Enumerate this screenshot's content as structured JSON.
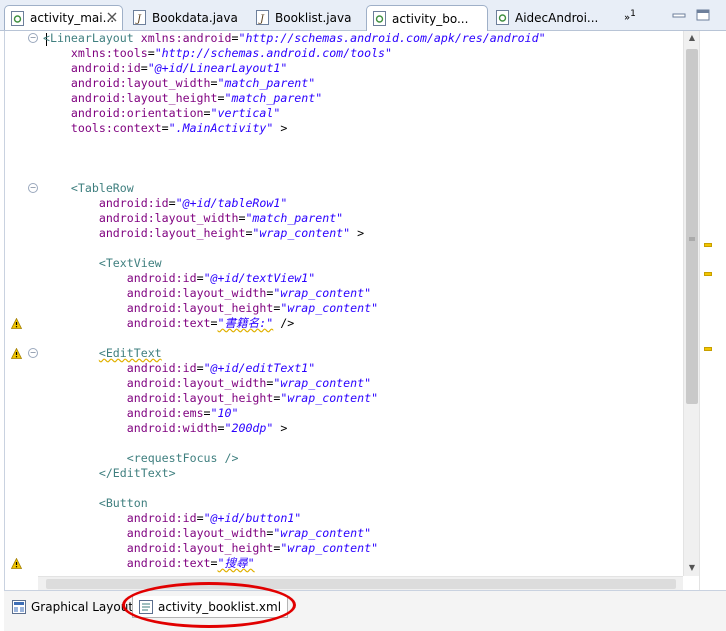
{
  "tabs": [
    {
      "label": "activity_mai...",
      "icon": "xml-file-icon",
      "has_close": true
    },
    {
      "label": "Bookdata.java",
      "icon": "java-file-icon",
      "has_close": false
    },
    {
      "label": "Booklist.java",
      "icon": "java-file-icon",
      "has_close": false
    },
    {
      "label": "activity_bo...",
      "icon": "xml-file-icon",
      "has_close": false
    },
    {
      "label": "AidecAndroi...",
      "icon": "xml-file-icon",
      "has_close": false
    }
  ],
  "overflow_count": "1",
  "code": [
    [
      [
        "tag",
        "<LinearLayout "
      ],
      [
        "attr",
        "xmlns:android"
      ],
      [
        "eq",
        "="
      ],
      [
        "val",
        "\"http://schemas.android.com/apk/res/android\""
      ]
    ],
    [
      [
        "pad",
        "    "
      ],
      [
        "attr",
        "xmlns:tools"
      ],
      [
        "eq",
        "="
      ],
      [
        "val",
        "\"http://schemas.android.com/tools\""
      ]
    ],
    [
      [
        "pad",
        "    "
      ],
      [
        "attr",
        "android:id"
      ],
      [
        "eq",
        "="
      ],
      [
        "val",
        "\"@+id/LinearLayout1\""
      ]
    ],
    [
      [
        "pad",
        "    "
      ],
      [
        "attr",
        "android:layout_width"
      ],
      [
        "eq",
        "="
      ],
      [
        "val",
        "\"match_parent\""
      ]
    ],
    [
      [
        "pad",
        "    "
      ],
      [
        "attr",
        "android:layout_height"
      ],
      [
        "eq",
        "="
      ],
      [
        "val",
        "\"match_parent\""
      ]
    ],
    [
      [
        "pad",
        "    "
      ],
      [
        "attr",
        "android:orientation"
      ],
      [
        "eq",
        "="
      ],
      [
        "val",
        "\"vertical\""
      ]
    ],
    [
      [
        "pad",
        "    "
      ],
      [
        "attr",
        "tools:context"
      ],
      [
        "eq",
        "="
      ],
      [
        "val",
        "\".MainActivity\""
      ],
      [
        "pun",
        " >"
      ]
    ],
    [],
    [],
    [],
    [
      [
        "pad",
        "    "
      ],
      [
        "tag",
        "<TableRow"
      ]
    ],
    [
      [
        "pad",
        "        "
      ],
      [
        "attr",
        "android:id"
      ],
      [
        "eq",
        "="
      ],
      [
        "val",
        "\"@+id/tableRow1\""
      ]
    ],
    [
      [
        "pad",
        "        "
      ],
      [
        "attr",
        "android:layout_width"
      ],
      [
        "eq",
        "="
      ],
      [
        "val",
        "\"match_parent\""
      ]
    ],
    [
      [
        "pad",
        "        "
      ],
      [
        "attr",
        "android:layout_height"
      ],
      [
        "eq",
        "="
      ],
      [
        "val",
        "\"wrap_content\""
      ],
      [
        "pun",
        " >"
      ]
    ],
    [],
    [
      [
        "pad",
        "        "
      ],
      [
        "tag",
        "<TextView"
      ]
    ],
    [
      [
        "pad",
        "            "
      ],
      [
        "attr",
        "android:id"
      ],
      [
        "eq",
        "="
      ],
      [
        "val",
        "\"@+id/textView1\""
      ]
    ],
    [
      [
        "pad",
        "            "
      ],
      [
        "attr",
        "android:layout_width"
      ],
      [
        "eq",
        "="
      ],
      [
        "val",
        "\"wrap_content\""
      ]
    ],
    [
      [
        "pad",
        "            "
      ],
      [
        "attr",
        "android:layout_height"
      ],
      [
        "eq",
        "="
      ],
      [
        "val",
        "\"wrap_content\""
      ]
    ],
    [
      [
        "pad",
        "            "
      ],
      [
        "attr",
        "android:text"
      ],
      [
        "eq",
        "="
      ],
      [
        "valsq",
        "\"書籍名:\""
      ],
      [
        "pun",
        " />"
      ]
    ],
    [],
    [
      [
        "pad",
        "        "
      ],
      [
        "tagsq",
        "<EditText"
      ]
    ],
    [
      [
        "pad",
        "            "
      ],
      [
        "attr",
        "android:id"
      ],
      [
        "eq",
        "="
      ],
      [
        "val",
        "\"@+id/editText1\""
      ]
    ],
    [
      [
        "pad",
        "            "
      ],
      [
        "attr",
        "android:layout_width"
      ],
      [
        "eq",
        "="
      ],
      [
        "val",
        "\"wrap_content\""
      ]
    ],
    [
      [
        "pad",
        "            "
      ],
      [
        "attr",
        "android:layout_height"
      ],
      [
        "eq",
        "="
      ],
      [
        "val",
        "\"wrap_content\""
      ]
    ],
    [
      [
        "pad",
        "            "
      ],
      [
        "attr",
        "android:ems"
      ],
      [
        "eq",
        "="
      ],
      [
        "val",
        "\"10\""
      ]
    ],
    [
      [
        "pad",
        "            "
      ],
      [
        "attr",
        "android:width"
      ],
      [
        "eq",
        "="
      ],
      [
        "val",
        "\"200dp\""
      ],
      [
        "pun",
        " >"
      ]
    ],
    [],
    [
      [
        "pad",
        "            "
      ],
      [
        "tag",
        "<requestFocus />"
      ]
    ],
    [
      [
        "pad",
        "        "
      ],
      [
        "tag",
        "</EditText>"
      ]
    ],
    [],
    [
      [
        "pad",
        "        "
      ],
      [
        "tag",
        "<Button"
      ]
    ],
    [
      [
        "pad",
        "            "
      ],
      [
        "attr",
        "android:id"
      ],
      [
        "eq",
        "="
      ],
      [
        "val",
        "\"@+id/button1\""
      ]
    ],
    [
      [
        "pad",
        "            "
      ],
      [
        "attr",
        "android:layout_width"
      ],
      [
        "eq",
        "="
      ],
      [
        "val",
        "\"wrap_content\""
      ]
    ],
    [
      [
        "pad",
        "            "
      ],
      [
        "attr",
        "android:layout_height"
      ],
      [
        "eq",
        "="
      ],
      [
        "val",
        "\"wrap_content\""
      ]
    ],
    [
      [
        "pad",
        "            "
      ],
      [
        "attr",
        "android:text"
      ],
      [
        "eq",
        "="
      ],
      [
        "valsq",
        "\"搜尋\""
      ]
    ]
  ],
  "warning_lines": [
    19,
    21,
    35
  ],
  "fold_lines": [
    0,
    10,
    21
  ],
  "bottom_tabs": [
    {
      "label": "Graphical Layout",
      "icon": "layout-icon",
      "active": false
    },
    {
      "label": "activity_booklist.xml",
      "icon": "xml-source-icon",
      "active": true
    }
  ],
  "colors": {
    "tag": "#3f7f7f",
    "attr": "#7f007f",
    "value": "#2a00ff",
    "warning": "#f2c500",
    "highlight": "#e10000"
  }
}
